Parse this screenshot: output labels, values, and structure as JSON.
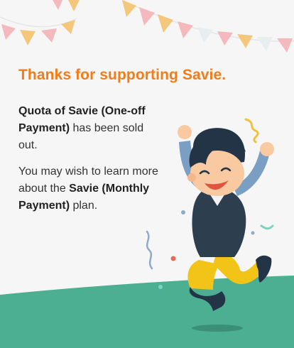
{
  "title": "Thanks for supporting Savie.",
  "message1": {
    "bold": "Quota of Savie (One-off Payment)",
    "rest": " has been sold out."
  },
  "message2": {
    "part1": "You may wish to learn more about the ",
    "bold": "Savie (Monthly Payment)",
    "part2": " plan."
  },
  "colors": {
    "accent": "#f07d1a",
    "ground": "#4caf92",
    "background": "#f6f6f6"
  },
  "illustration": "celebrating-man"
}
